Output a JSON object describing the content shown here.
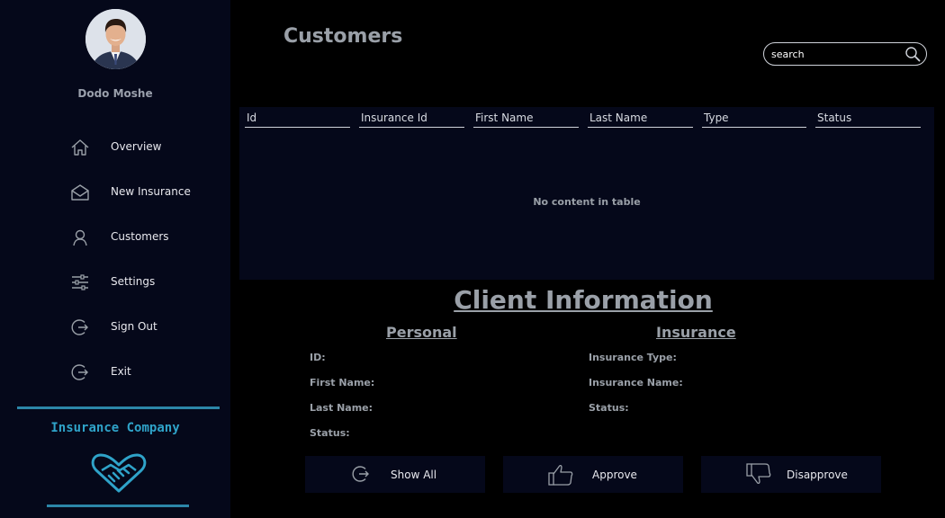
{
  "user": {
    "name": "Dodo Moshe"
  },
  "sidebar": {
    "items": [
      {
        "label": "Overview",
        "icon": "home-icon"
      },
      {
        "label": "New Insurance",
        "icon": "envelope-icon"
      },
      {
        "label": "Customers",
        "icon": "user-icon"
      },
      {
        "label": "Settings",
        "icon": "sliders-icon"
      },
      {
        "label": "Sign Out",
        "icon": "sign-out-icon"
      },
      {
        "label": "Exit",
        "icon": "exit-icon"
      }
    ],
    "brand": {
      "name": "Insurance Company",
      "logo": "handshake-heart-icon"
    }
  },
  "header": {
    "title": "Customers"
  },
  "search": {
    "placeholder": "search",
    "value": ""
  },
  "table": {
    "columns": [
      "Id",
      "Insurance Id",
      "First Name",
      "Last Name",
      "Type",
      "Status"
    ],
    "rows": [],
    "empty_message": "No content in table"
  },
  "client_info": {
    "title": "Client Information",
    "personal": {
      "title": "Personal",
      "fields": [
        "ID:",
        "First Name:",
        "Last Name:",
        "Status:"
      ]
    },
    "insurance": {
      "title": "Insurance",
      "fields": [
        "Insurance Type:",
        "Insurance Name:",
        "Status:"
      ]
    }
  },
  "actions": {
    "show_all": "Show All",
    "approve": "Approve",
    "disapprove": "Disapprove"
  },
  "colors": {
    "sidebar_bg": "#05081a",
    "page_bg": "#000000",
    "accent": "#2c86a8",
    "muted_text": "#9aa0a8"
  }
}
